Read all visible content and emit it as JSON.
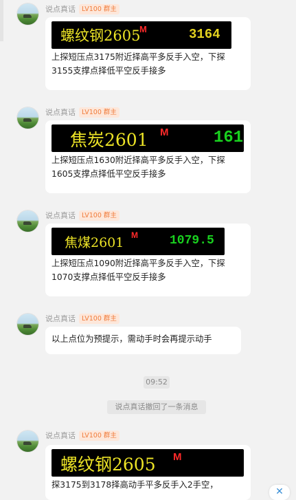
{
  "user": {
    "name": "说点真话",
    "badge": "LV100 群主"
  },
  "messages": [
    {
      "ticker": {
        "name": "螺纹钢2605",
        "marker": "M",
        "price": "3164",
        "price_color": "#e4d21f"
      },
      "text": "上探短压点3175附近择高平多反手入空，下探3155支撑点择低平空反手接多"
    },
    {
      "ticker": {
        "name": "焦炭2601",
        "marker": "M",
        "price": "161",
        "price_color": "#19d11f"
      },
      "text": "上探短压点1630附近择高平多反手入空，下探1605支撑点择低平空反手接多"
    },
    {
      "ticker": {
        "name": "焦煤2601",
        "marker": "M",
        "price": "1079.5",
        "price_color": "#19d11f"
      },
      "text": "上探短压点1090附近择高平多反手入空，下探1070支撑点择低平空反手接多"
    },
    {
      "text": "以上点位为预提示，需动手时会再提示动手"
    },
    {
      "ticker": {
        "name": "螺纹钢2605",
        "marker": "M",
        "price": ""
      },
      "text": "探3175到3178择高动手平多反手入2手空，"
    }
  ],
  "time_divider": "09:52",
  "system_notice": "说点真话撤回了一条消息",
  "colors": {
    "background": "#f2f2f2",
    "bubble": "#ffffff",
    "badge_text": "#f07b3a",
    "badge_bg": "#fde7da",
    "ticker_text": "#ece326",
    "marker": "#ff2a2a"
  },
  "corner_button_icon": "close-collapse-icon"
}
